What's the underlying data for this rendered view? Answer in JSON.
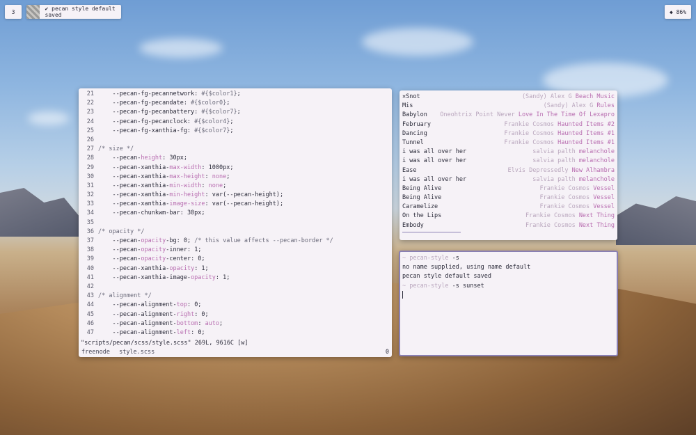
{
  "topbar": {
    "workspace": "3",
    "notification": "✔ pecan style default saved",
    "volume": "◆ 86%"
  },
  "editor": {
    "lines": [
      {
        "n": "21",
        "parts": [
          [
            "k",
            "    --pecan-fg-pecannetwork: "
          ],
          [
            "c",
            "#{$color1}"
          ],
          [
            "k",
            ";"
          ]
        ]
      },
      {
        "n": "22",
        "parts": [
          [
            "k",
            "    --pecan-fg-pecandate: "
          ],
          [
            "c",
            "#{$color0}"
          ],
          [
            "k",
            ";"
          ]
        ]
      },
      {
        "n": "23",
        "parts": [
          [
            "k",
            "    --pecan-fg-pecanbattery: "
          ],
          [
            "c",
            "#{$color7}"
          ],
          [
            "k",
            ";"
          ]
        ]
      },
      {
        "n": "24",
        "parts": [
          [
            "k",
            "    --pecan-fg-pecanclock: "
          ],
          [
            "c",
            "#{$color4}"
          ],
          [
            "k",
            ";"
          ]
        ]
      },
      {
        "n": "25",
        "parts": [
          [
            "k",
            "    --pecan-fg-xanthia-fg: "
          ],
          [
            "c",
            "#{$color7}"
          ],
          [
            "k",
            ";"
          ]
        ]
      },
      {
        "n": "26",
        "parts": []
      },
      {
        "n": "27",
        "parts": [
          [
            "c",
            "/* size */"
          ]
        ]
      },
      {
        "n": "28",
        "parts": [
          [
            "k",
            "    --pecan-"
          ],
          [
            "p",
            "height"
          ],
          [
            "k",
            ": 30px;"
          ]
        ]
      },
      {
        "n": "29",
        "parts": [
          [
            "k",
            "    --pecan-xanthia-"
          ],
          [
            "p",
            "max-width"
          ],
          [
            "k",
            ": 1000px;"
          ]
        ]
      },
      {
        "n": "30",
        "parts": [
          [
            "k",
            "    --pecan-xanthia-"
          ],
          [
            "p",
            "max-height"
          ],
          [
            "k",
            ": "
          ],
          [
            "p",
            "none"
          ],
          [
            "k",
            ";"
          ]
        ]
      },
      {
        "n": "31",
        "parts": [
          [
            "k",
            "    --pecan-xanthia-"
          ],
          [
            "p",
            "min-width"
          ],
          [
            "k",
            ": "
          ],
          [
            "p",
            "none"
          ],
          [
            "k",
            ";"
          ]
        ]
      },
      {
        "n": "32",
        "parts": [
          [
            "k",
            "    --pecan-xanthia-"
          ],
          [
            "p",
            "min-height"
          ],
          [
            "k",
            ": var(--pecan-height);"
          ]
        ]
      },
      {
        "n": "33",
        "parts": [
          [
            "k",
            "    --pecan-xanthia-"
          ],
          [
            "p",
            "image-size"
          ],
          [
            "k",
            ": var(--pecan-height);"
          ]
        ]
      },
      {
        "n": "34",
        "parts": [
          [
            "k",
            "    --pecan-chunkwm-bar: "
          ],
          [
            "k",
            "30px;"
          ]
        ]
      },
      {
        "n": "35",
        "parts": []
      },
      {
        "n": "36",
        "parts": [
          [
            "c",
            "/* opacity */"
          ]
        ]
      },
      {
        "n": "37",
        "parts": [
          [
            "k",
            "    --pecan-"
          ],
          [
            "p",
            "opacity"
          ],
          [
            "k",
            "-bg: 0; "
          ],
          [
            "c",
            "/* this value affects --pecan-border */"
          ]
        ]
      },
      {
        "n": "38",
        "parts": [
          [
            "k",
            "    --pecan-"
          ],
          [
            "p",
            "opacity"
          ],
          [
            "k",
            "-inner: 1;"
          ]
        ]
      },
      {
        "n": "39",
        "parts": [
          [
            "k",
            "    --pecan-"
          ],
          [
            "p",
            "opacity"
          ],
          [
            "k",
            "-center: 0;"
          ]
        ]
      },
      {
        "n": "40",
        "parts": [
          [
            "k",
            "    --pecan-xanthia-"
          ],
          [
            "p",
            "opacity"
          ],
          [
            "k",
            ": 1;"
          ]
        ]
      },
      {
        "n": "41",
        "parts": [
          [
            "k",
            "    --pecan-xanthia-image-"
          ],
          [
            "p",
            "opacity"
          ],
          [
            "k",
            ": 1;"
          ]
        ]
      },
      {
        "n": "42",
        "parts": []
      },
      {
        "n": "43",
        "parts": [
          [
            "c",
            "/* alignment */"
          ]
        ]
      },
      {
        "n": "44",
        "parts": [
          [
            "k",
            "    --pecan-alignment-"
          ],
          [
            "p",
            "top"
          ],
          [
            "k",
            ": 0;"
          ]
        ]
      },
      {
        "n": "45",
        "parts": [
          [
            "k",
            "    --pecan-alignment-"
          ],
          [
            "p",
            "right"
          ],
          [
            "k",
            ": 0;"
          ]
        ]
      },
      {
        "n": "46",
        "parts": [
          [
            "k",
            "    --pecan-alignment-"
          ],
          [
            "p",
            "bottom"
          ],
          [
            "k",
            ": "
          ],
          [
            "p",
            "auto"
          ],
          [
            "k",
            ";"
          ]
        ]
      },
      {
        "n": "47",
        "parts": [
          [
            "k",
            "    --pecan-alignment-"
          ],
          [
            "p",
            "left"
          ],
          [
            "k",
            ": 0;"
          ]
        ]
      }
    ],
    "file_status": "\"scripts/pecan/scss/style.scss\" 269L, 9616C [w]",
    "bar_left_1": "freenode",
    "bar_left_2": "style.scss",
    "bar_right": "0"
  },
  "music": {
    "tracks": [
      {
        "title": "✕Snot",
        "artist": "(Sandy) Alex G ",
        "album": "Beach Music"
      },
      {
        "title": "Mis",
        "artist": "(Sandy) Alex G ",
        "album": "Rules"
      },
      {
        "title": "Babylon",
        "artist": "Oneohtrix Point Never ",
        "album": "Love In The Time Of Lexapro"
      },
      {
        "title": "February",
        "artist": "Frankie Cosmos ",
        "album": "Haunted Items #2"
      },
      {
        "title": "Dancing",
        "artist": "Frankie Cosmos ",
        "album": "Haunted Items #1"
      },
      {
        "title": "Tunnel",
        "artist": "Frankie Cosmos ",
        "album": "Haunted Items #1"
      },
      {
        "title": "i was all over her",
        "artist": "salvia palth ",
        "album": "melanchole"
      },
      {
        "title": "i was all over her",
        "artist": "salvia palth ",
        "album": "melanchole"
      },
      {
        "title": "Ease",
        "artist": "Elvis Depressedly ",
        "album": "New Alhambra"
      },
      {
        "title": "i was all over her",
        "artist": "salvia palth ",
        "album": "melanchole"
      },
      {
        "title": "Being Alive",
        "artist": "Frankie Cosmos ",
        "album": "Vessel"
      },
      {
        "title": "Being Alive",
        "artist": "Frankie Cosmos ",
        "album": "Vessel"
      },
      {
        "title": "Caramelize",
        "artist": "Frankie Cosmos ",
        "album": "Vessel"
      },
      {
        "title": "On the Lips",
        "artist": "Frankie Cosmos ",
        "album": "Next Thing"
      },
      {
        "title": "Embody",
        "artist": "Frankie Cosmos ",
        "album": "Next Thing"
      }
    ]
  },
  "terminal": {
    "lines": [
      {
        "prompt": "~ pecan-style ",
        "cmd": "-s"
      },
      {
        "prompt": "",
        "cmd": "no name supplied, using name default"
      },
      {
        "prompt": "",
        "cmd": "pecan style default saved"
      },
      {
        "prompt": "~ pecan-style ",
        "cmd": "-s sunset"
      }
    ]
  }
}
